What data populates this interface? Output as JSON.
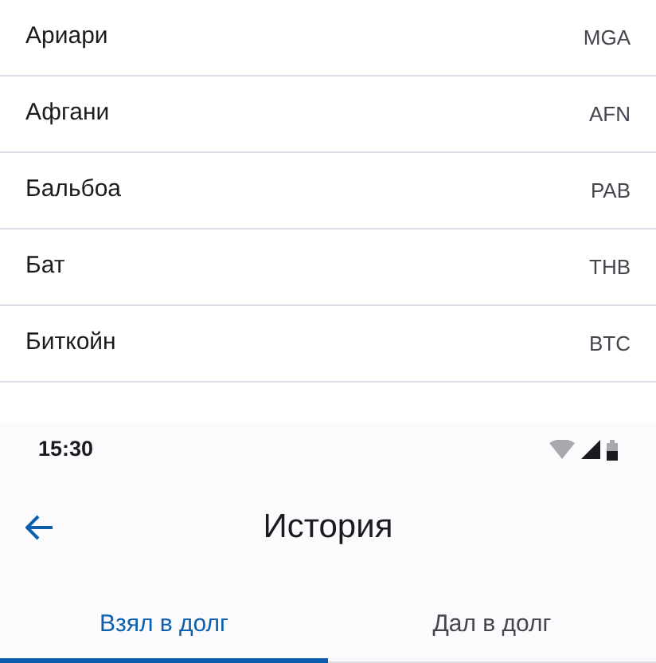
{
  "currencies": [
    {
      "name": "Ариари",
      "code": "MGA"
    },
    {
      "name": "Афгани",
      "code": "AFN"
    },
    {
      "name": "Бальбоа",
      "code": "PAB"
    },
    {
      "name": "Бат",
      "code": "THB"
    },
    {
      "name": "Биткойн",
      "code": "BTC"
    }
  ],
  "status_bar": {
    "time": "15:30"
  },
  "app_bar": {
    "title": "История"
  },
  "tabs": [
    {
      "label": "Взял в долг",
      "selected": true
    },
    {
      "label": "Дал в долг",
      "selected": false
    }
  ]
}
